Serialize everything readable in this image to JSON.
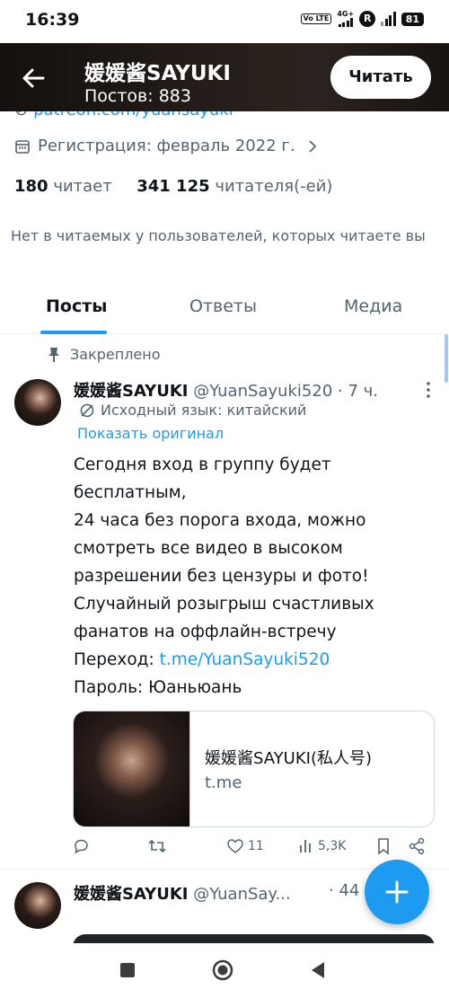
{
  "status_bar": {
    "time": "16:39",
    "volte": "Vo LTE",
    "network": "4G+",
    "r_badge": "R",
    "battery": "81"
  },
  "header": {
    "name": "媛媛酱SAYUKI",
    "posts": "Постов: 883",
    "follow_label": "Читать"
  },
  "profile": {
    "link": "patreon.com/yuansayuki",
    "registration": "Регистрация: февраль 2022 г.",
    "following_count": "180",
    "following_label": "читает",
    "followers_count": "341 125",
    "followers_label": "читателя(-ей)",
    "mutual_note": "Нет в читаемых у пользователей, которых читаете вы"
  },
  "tabs": [
    {
      "label": "Посты",
      "active": true
    },
    {
      "label": "Ответы",
      "active": false
    },
    {
      "label": "Медиа",
      "active": false
    }
  ],
  "pinned_tweet": {
    "pinned_label": "Закреплено",
    "name": "媛媛酱SAYUKI",
    "handle_time": "@YuanSayuki520 · 7 ч.",
    "translated_from": "Исходный язык: китайский",
    "show_original": "Показать оригинал",
    "text_lines": [
      "Сегодня вход в группу будет",
      "бесплатным,",
      "24 часа без порога входа, можно",
      "смотреть все видео в высоком",
      "разрешении без цензуры и фото!",
      "Случайный розыгрыш счастливых",
      "фанатов на оффлайн-встречу"
    ],
    "link_prefix": "Переход: ",
    "link_text": "t.me/YuanSayuki520",
    "password_line": "Пароль: Юаньюань",
    "card_title": "媛媛酱SAYUKI(私人号)",
    "card_domain": "t.me",
    "likes": "11",
    "views": "5,3K"
  },
  "second_tweet": {
    "name": "媛媛酱SAYUKI",
    "handle": "@YuanSay...",
    "time": "· 44"
  },
  "colors": {
    "accent": "#1d9bf0",
    "text_primary": "#0f1419",
    "text_secondary": "#536471",
    "border": "#cfd9de"
  },
  "icons": [
    "back-arrow-icon",
    "link-icon",
    "calendar-icon",
    "chevron-right-icon",
    "pin-icon",
    "more-dots-icon",
    "translate-icon",
    "reply-icon",
    "retweet-icon",
    "like-icon",
    "views-icon",
    "bookmark-icon",
    "share-icon",
    "compose-plus-icon",
    "nav-recents-icon",
    "nav-home-icon",
    "nav-back-icon"
  ]
}
